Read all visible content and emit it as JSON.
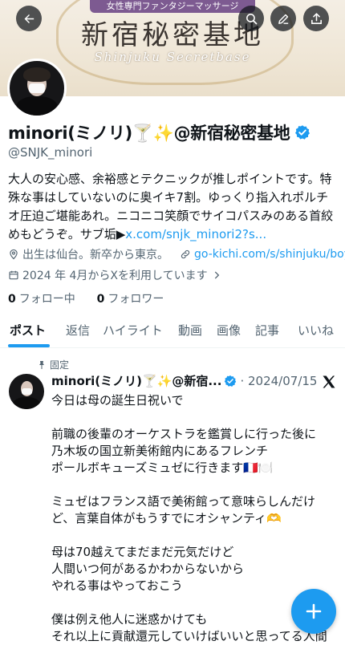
{
  "banner": {
    "ribbon": "女性専門ファンタジーマッサージ",
    "title": "新宿秘密基地",
    "subtitle": "Shinjuku Secretbase"
  },
  "profile": {
    "name": "minori(ミノリ)🍸✨@新宿秘密基地",
    "handle": "@SNJK_minori",
    "bio_text": "大人の安心感、余裕感とテクニックが推しポイントです。特殊な事はしていないのに奥イキ7割。ゆっくり指入れポルチオ圧迫ご堪能あれ。ニコニコ笑顔でサイコパスみのある首絞めもどうぞ。サブ垢▶",
    "bio_link": "x.com/snjk_minori2?s...",
    "location": "出生は仙台。新卒から東京。",
    "website": "go-kichi.com/s/shinjuku/boy...",
    "joined": "2024 年 4月からXを利用しています",
    "following_count": "0",
    "following_label": "フォロー中",
    "followers_count": "0",
    "followers_label": "フォロワー"
  },
  "tabs": [
    "ポスト",
    "返信",
    "ハイライト",
    "動画",
    "画像",
    "記事",
    "いいね"
  ],
  "post": {
    "pinned_label": "固定",
    "author": "minori(ミノリ)🍸✨@新宿...",
    "date": "· 2024/07/15",
    "lines": [
      "今日は母の誕生日祝いで",
      "",
      "前職の後輩のオーケストラを鑑賞しに行った後に",
      "乃木坂の国立新美術館内にあるフレンチ",
      "ポールボキューズミュゼに行きます🇫🇷🍽️",
      "",
      "ミュゼはフランス語で美術館って意味らしんだけ",
      "ど、言葉自体がもうすでにオシャンティ🫶",
      "",
      "母は70越えてまだまだ元気だけど",
      "人間いつ何があるかわからないから",
      "やれる事はやっておこう",
      "",
      "僕は例え他人に迷惑かけても",
      "それ以上に貢献還元していけばいいと思ってる人間"
    ]
  },
  "colors": {
    "accent": "#1d9bf0",
    "text": "#0f1419",
    "muted": "#536471"
  },
  "icons": [
    "back-arrow-icon",
    "search-icon",
    "edit-icon",
    "share-icon",
    "verified-badge-icon",
    "location-icon",
    "link-icon",
    "calendar-icon",
    "chevron-right-icon",
    "pin-icon",
    "x-logo-icon",
    "plus-icon"
  ]
}
